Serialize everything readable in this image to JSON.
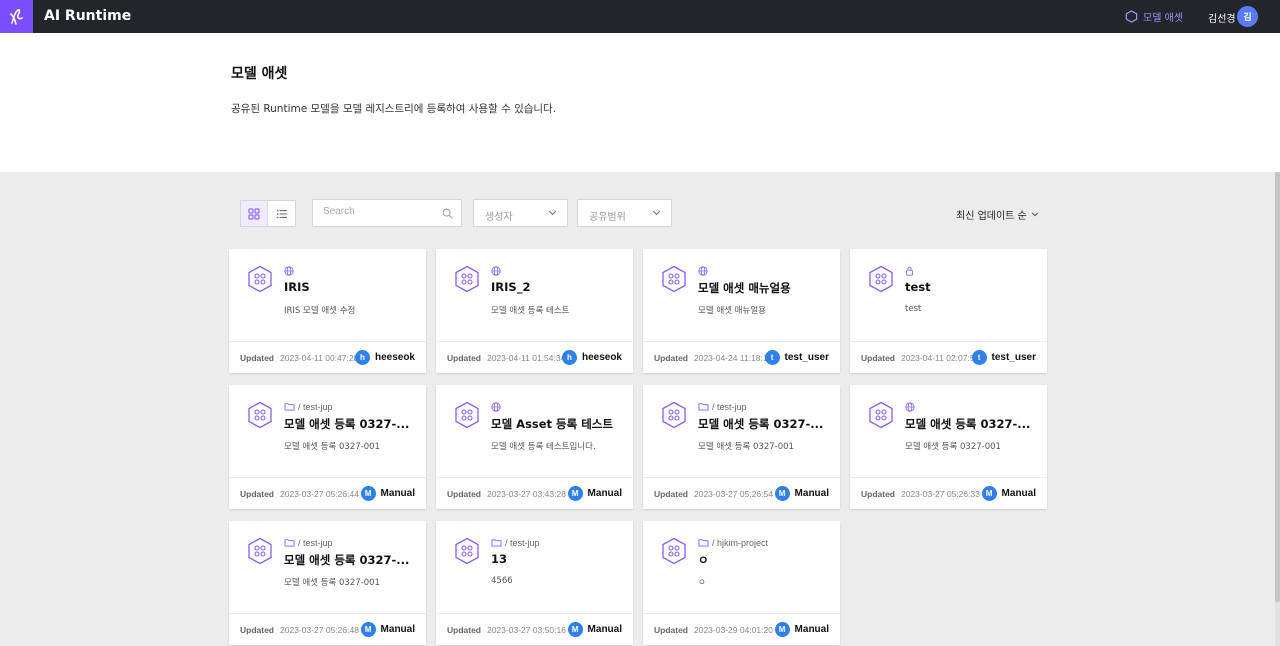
{
  "app": {
    "title": "AI Runtime",
    "nav_label": "모델 애셋",
    "user_name": "김선경",
    "user_initial": "김"
  },
  "header": {
    "title": "모델 애셋",
    "description": "공유된 Runtime 모델을 모델 레지스트리에 등록하여 사용할 수 있습니다."
  },
  "toolbar": {
    "search_placeholder": "Search",
    "creator_filter": "생성자",
    "scope_filter": "공유범위",
    "sort_label": "최신 업데이트 순"
  },
  "colors": {
    "accent": "#7c4dff",
    "topbar": "#22252a",
    "avatar": "#2f80ed"
  },
  "cards": [
    {
      "scope_icon": "globe-icon",
      "scope": "",
      "title": "IRIS",
      "desc": "IRIS 모델 애셋 수정",
      "updated_label": "Updated",
      "updated": "2023-04-11 00:47:28",
      "user_initial": "h",
      "user": "heeseok"
    },
    {
      "scope_icon": "globe-icon",
      "scope": "",
      "title": "IRIS_2",
      "desc": "모델 애셋 등록 테스트",
      "updated_label": "Updated",
      "updated": "2023-04-11 01:54:34",
      "user_initial": "h",
      "user": "heeseok"
    },
    {
      "scope_icon": "globe-icon",
      "scope": "",
      "title": "모델 애셋 매뉴얼용",
      "desc": "모델 애셋 매뉴얼용",
      "updated_label": "Updated",
      "updated": "2023-04-24 11:18:11",
      "user_initial": "t",
      "user": "test_user"
    },
    {
      "scope_icon": "lock-icon",
      "scope": "",
      "title": "test",
      "desc": "test",
      "updated_label": "Updated",
      "updated": "2023-04-11 02:07:56",
      "user_initial": "t",
      "user": "test_user"
    },
    {
      "scope_icon": "folder-icon",
      "scope": "/ test-jup",
      "title": "모델 애셋 등록 0327-...",
      "desc": "모델 애셋 등록 0327-001",
      "updated_label": "Updated",
      "updated": "2023-03-27 05:26:44",
      "user_initial": "M",
      "user": "Manual"
    },
    {
      "scope_icon": "globe-icon",
      "scope": "",
      "title": "모델 Asset 등록 테스트",
      "desc": "모델 애셋 등록 테스트입니다.",
      "updated_label": "Updated",
      "updated": "2023-03-27 03:43:28",
      "user_initial": "M",
      "user": "Manual"
    },
    {
      "scope_icon": "folder-icon",
      "scope": "/ test-jup",
      "title": "모델 애셋 등록 0327-...",
      "desc": "모델 애셋 등록 0327-001",
      "updated_label": "Updated",
      "updated": "2023-03-27 05:26:54",
      "user_initial": "M",
      "user": "Manual"
    },
    {
      "scope_icon": "globe-icon",
      "scope": "",
      "title": "모델 애셋 등록 0327-...",
      "desc": "모델 애셋 등록 0327-001",
      "updated_label": "Updated",
      "updated": "2023-03-27 05:26:33",
      "user_initial": "M",
      "user": "Manual"
    },
    {
      "scope_icon": "folder-icon",
      "scope": "/ test-jup",
      "title": "모델 애셋 등록 0327-...",
      "desc": "모델 애셋 등록 0327-001",
      "updated_label": "Updated",
      "updated": "2023-03-27 05:26:48",
      "user_initial": "M",
      "user": "Manual"
    },
    {
      "scope_icon": "folder-icon",
      "scope": "/ test-jup",
      "title": "13",
      "desc": "4566",
      "updated_label": "Updated",
      "updated": "2023-03-27 03:50:16",
      "user_initial": "M",
      "user": "Manual"
    },
    {
      "scope_icon": "folder-icon",
      "scope": "/ hjkim-project",
      "title": "ㅇ",
      "desc": "ㅇ",
      "updated_label": "Updated",
      "updated": "2023-03-29 04:01:20",
      "user_initial": "M",
      "user": "Manual"
    }
  ]
}
